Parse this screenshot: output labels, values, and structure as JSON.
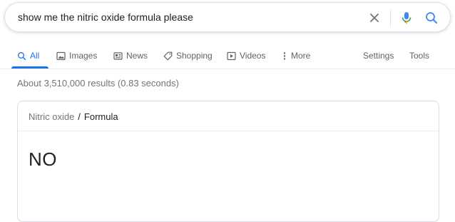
{
  "search": {
    "query": "show me the nitric oxide formula please"
  },
  "icons": {
    "clear": "close-icon",
    "mic": "microphone-icon",
    "search": "search-icon"
  },
  "colors": {
    "accent": "#1a73e8",
    "mic_blue": "#4285f4"
  },
  "tabs": {
    "items": [
      {
        "label": "All",
        "icon": "search-icon",
        "active": true
      },
      {
        "label": "Images",
        "icon": "image-icon"
      },
      {
        "label": "News",
        "icon": "newspaper-icon"
      },
      {
        "label": "Shopping",
        "icon": "tag-icon"
      },
      {
        "label": "Videos",
        "icon": "play-icon"
      },
      {
        "label": "More",
        "icon": "more-vertical-icon"
      }
    ],
    "settings": "Settings",
    "tools": "Tools"
  },
  "results": {
    "stats": "About 3,510,000 results (0.83 seconds)"
  },
  "card": {
    "breadcrumb_parent": "Nitric oxide",
    "breadcrumb_separator": "/",
    "breadcrumb_current": "Formula",
    "formula": "NO"
  }
}
